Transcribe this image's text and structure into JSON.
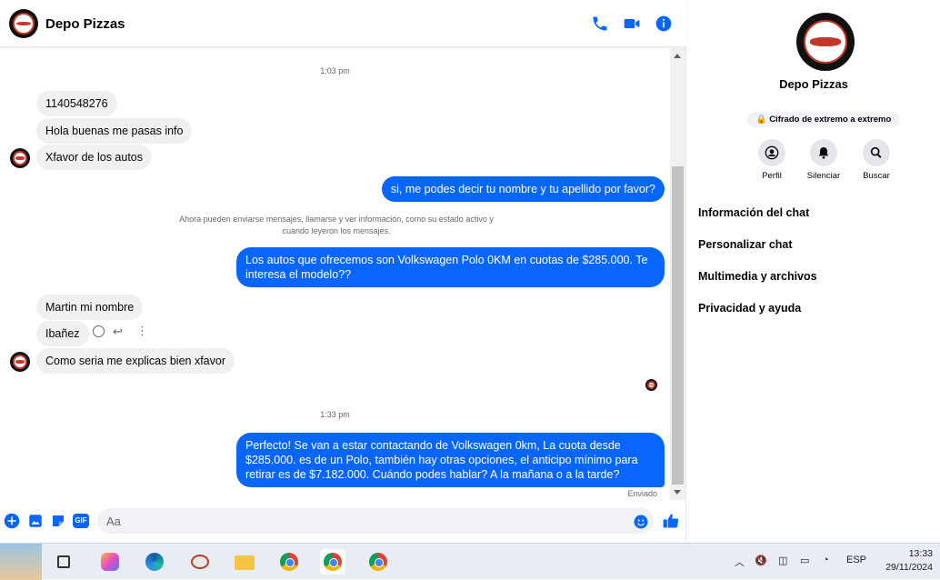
{
  "header": {
    "title": "Depo Pizzas"
  },
  "messages": {
    "time_1": "1:03 pm",
    "in_1": "1140548276",
    "in_2": "Hola buenas me pasas info",
    "in_3": "Xfavor de los autos",
    "out_1": "si, me podes decir tu nombre y tu apellido por favor?",
    "system": "Ahora pueden enviarse mensajes, llamarse y ver información, como su estado activo y cuándo leyeron los mensajes.",
    "out_2": "Los autos que ofrecemos son Volkswagen Polo 0KM en cuotas de $285.000. Te interesa el modelo??",
    "in_4": "Martin mi nombre",
    "in_5": "Ibañez",
    "in_6": "Como seria me explicas bien xfavor",
    "time_2": "1:33 pm",
    "out_3": "Perfecto!  Se van a estar contactando de Volkswagen 0km, La cuota desde $285.000. es de un Polo, también hay otras opciones, el anticipo mínimo para retirar es de $7.182.000. Cuándo podes hablar? A la mañana o a la tarde?",
    "status": "Enviado"
  },
  "composer": {
    "placeholder": "Aa",
    "gif_label": "GIF"
  },
  "panel": {
    "name": "Depo Pizzas",
    "encryption": "Cifrado de extremo a extremo",
    "buttons": [
      {
        "label": "Perfil",
        "icon": "profile-icon"
      },
      {
        "label": "Silenciar",
        "icon": "bell-icon"
      },
      {
        "label": "Buscar",
        "icon": "search-icon"
      }
    ],
    "menu": [
      "Información del chat",
      "Personalizar chat",
      "Multimedia y archivos",
      "Privacidad y ayuda"
    ]
  },
  "taskbar": {
    "language": "ESP",
    "time": "13:33",
    "date": "29/11/2024"
  },
  "colors": {
    "accent": "#0866ff",
    "bubble_in": "#f0f0f0"
  }
}
